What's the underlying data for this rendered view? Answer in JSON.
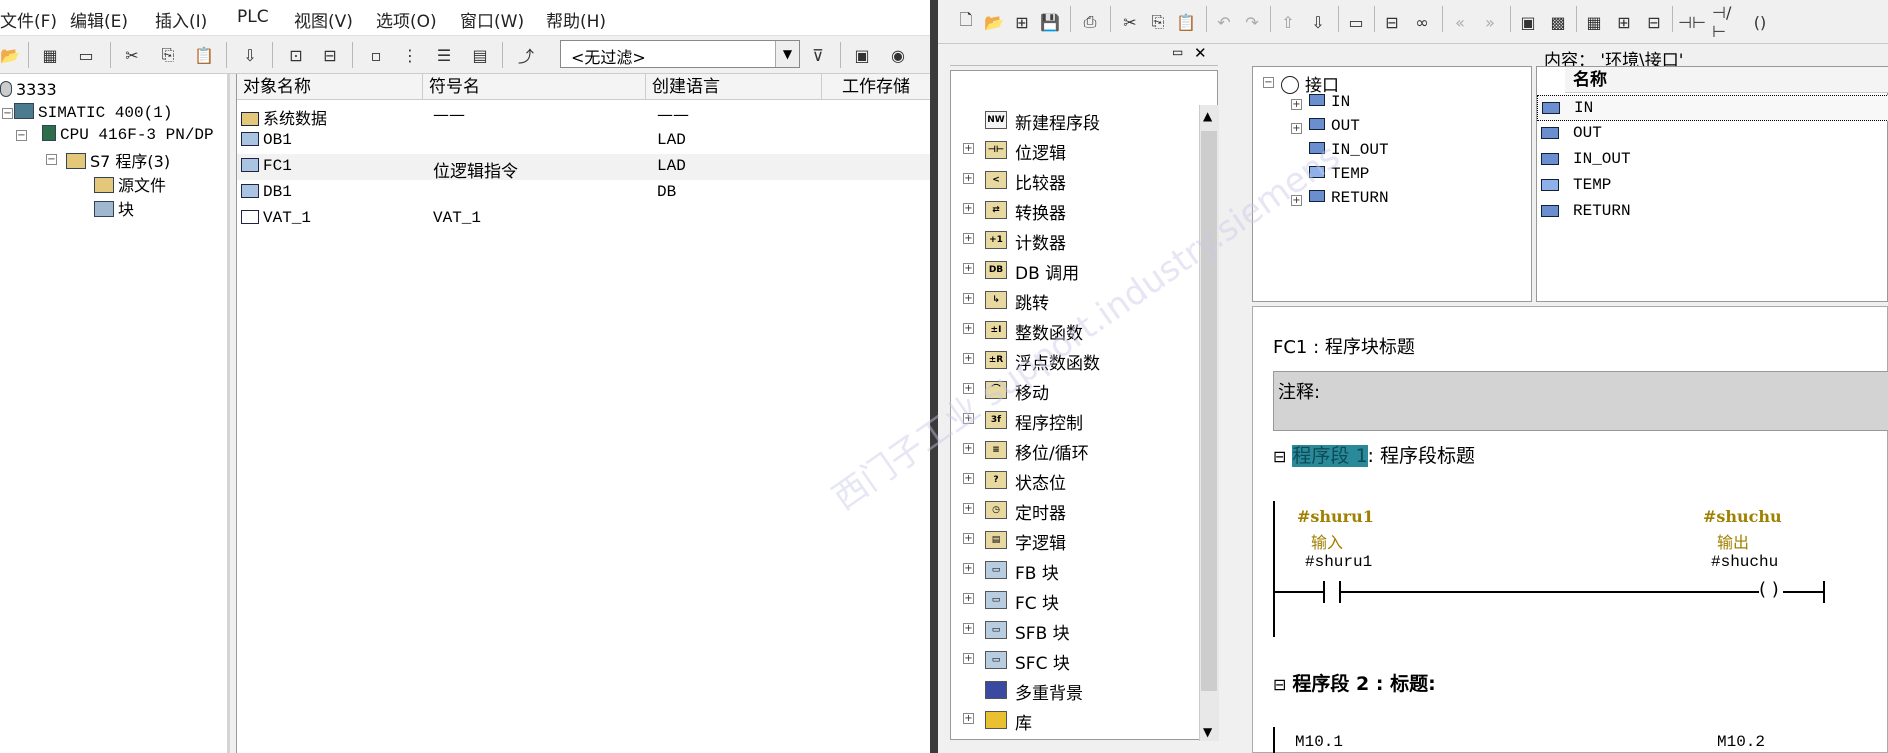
{
  "left": {
    "menu": [
      "文件(F)",
      "编辑(E)",
      "插入(I)",
      "PLC",
      "视图(V)",
      "选项(O)",
      "窗口(W)",
      "帮助(H)"
    ],
    "filter": "<无过滤>",
    "tree": [
      "3333",
      "SIMATIC 400(1)",
      "CPU 416F-3 PN/DP",
      "S7 程序(3)",
      "源文件",
      "块"
    ],
    "columns": [
      "对象名称",
      "符号名",
      "创建语言",
      "工作存储"
    ],
    "rows": [
      {
        "name": "系统数据",
        "symbol": "——",
        "lang": "——"
      },
      {
        "name": "OB1",
        "symbol": "",
        "lang": "LAD"
      },
      {
        "name": "FC1",
        "symbol": "位逻辑指令",
        "lang": "LAD"
      },
      {
        "name": "DB1",
        "symbol": "",
        "lang": "DB"
      },
      {
        "name": "VAT_1",
        "symbol": "VAT_1",
        "lang": ""
      }
    ]
  },
  "catalog": {
    "items": [
      "新建程序段",
      "位逻辑",
      "比较器",
      "转换器",
      "计数器",
      "DB 调用",
      "跳转",
      "整数函数",
      "浮点数函数",
      "移动",
      "程序控制",
      "移位/循环",
      "状态位",
      "定时器",
      "字逻辑",
      "FB 块",
      "FC 块",
      "SFB 块",
      "SFC 块",
      "多重背景",
      "库"
    ]
  },
  "interface": {
    "content": "内容：  '环境\\接口'",
    "tree_root": "接口",
    "tree": [
      "IN",
      "OUT",
      "IN_OUT",
      "TEMP",
      "RETURN"
    ],
    "col_name": "名称",
    "list": [
      "IN",
      "OUT",
      "IN_OUT",
      "TEMP",
      "RETURN"
    ]
  },
  "editor": {
    "fc_title": "FC1 : 程序块标题",
    "comment": "注释:",
    "seg1_label": "程序段 1",
    "seg1_title": ": 程序段标题",
    "in_sym": "#shuru1",
    "in_cmt": "输入",
    "in_addr": "#shuru1",
    "out_sym": "#shuchu",
    "out_cmt": "输出",
    "out_addr": "#shuchu",
    "seg2": "程序段  2 : 标题:",
    "m1": "M10.1",
    "m2": "M10.2"
  },
  "watermark": "西门子工业 support.industry.siemens"
}
